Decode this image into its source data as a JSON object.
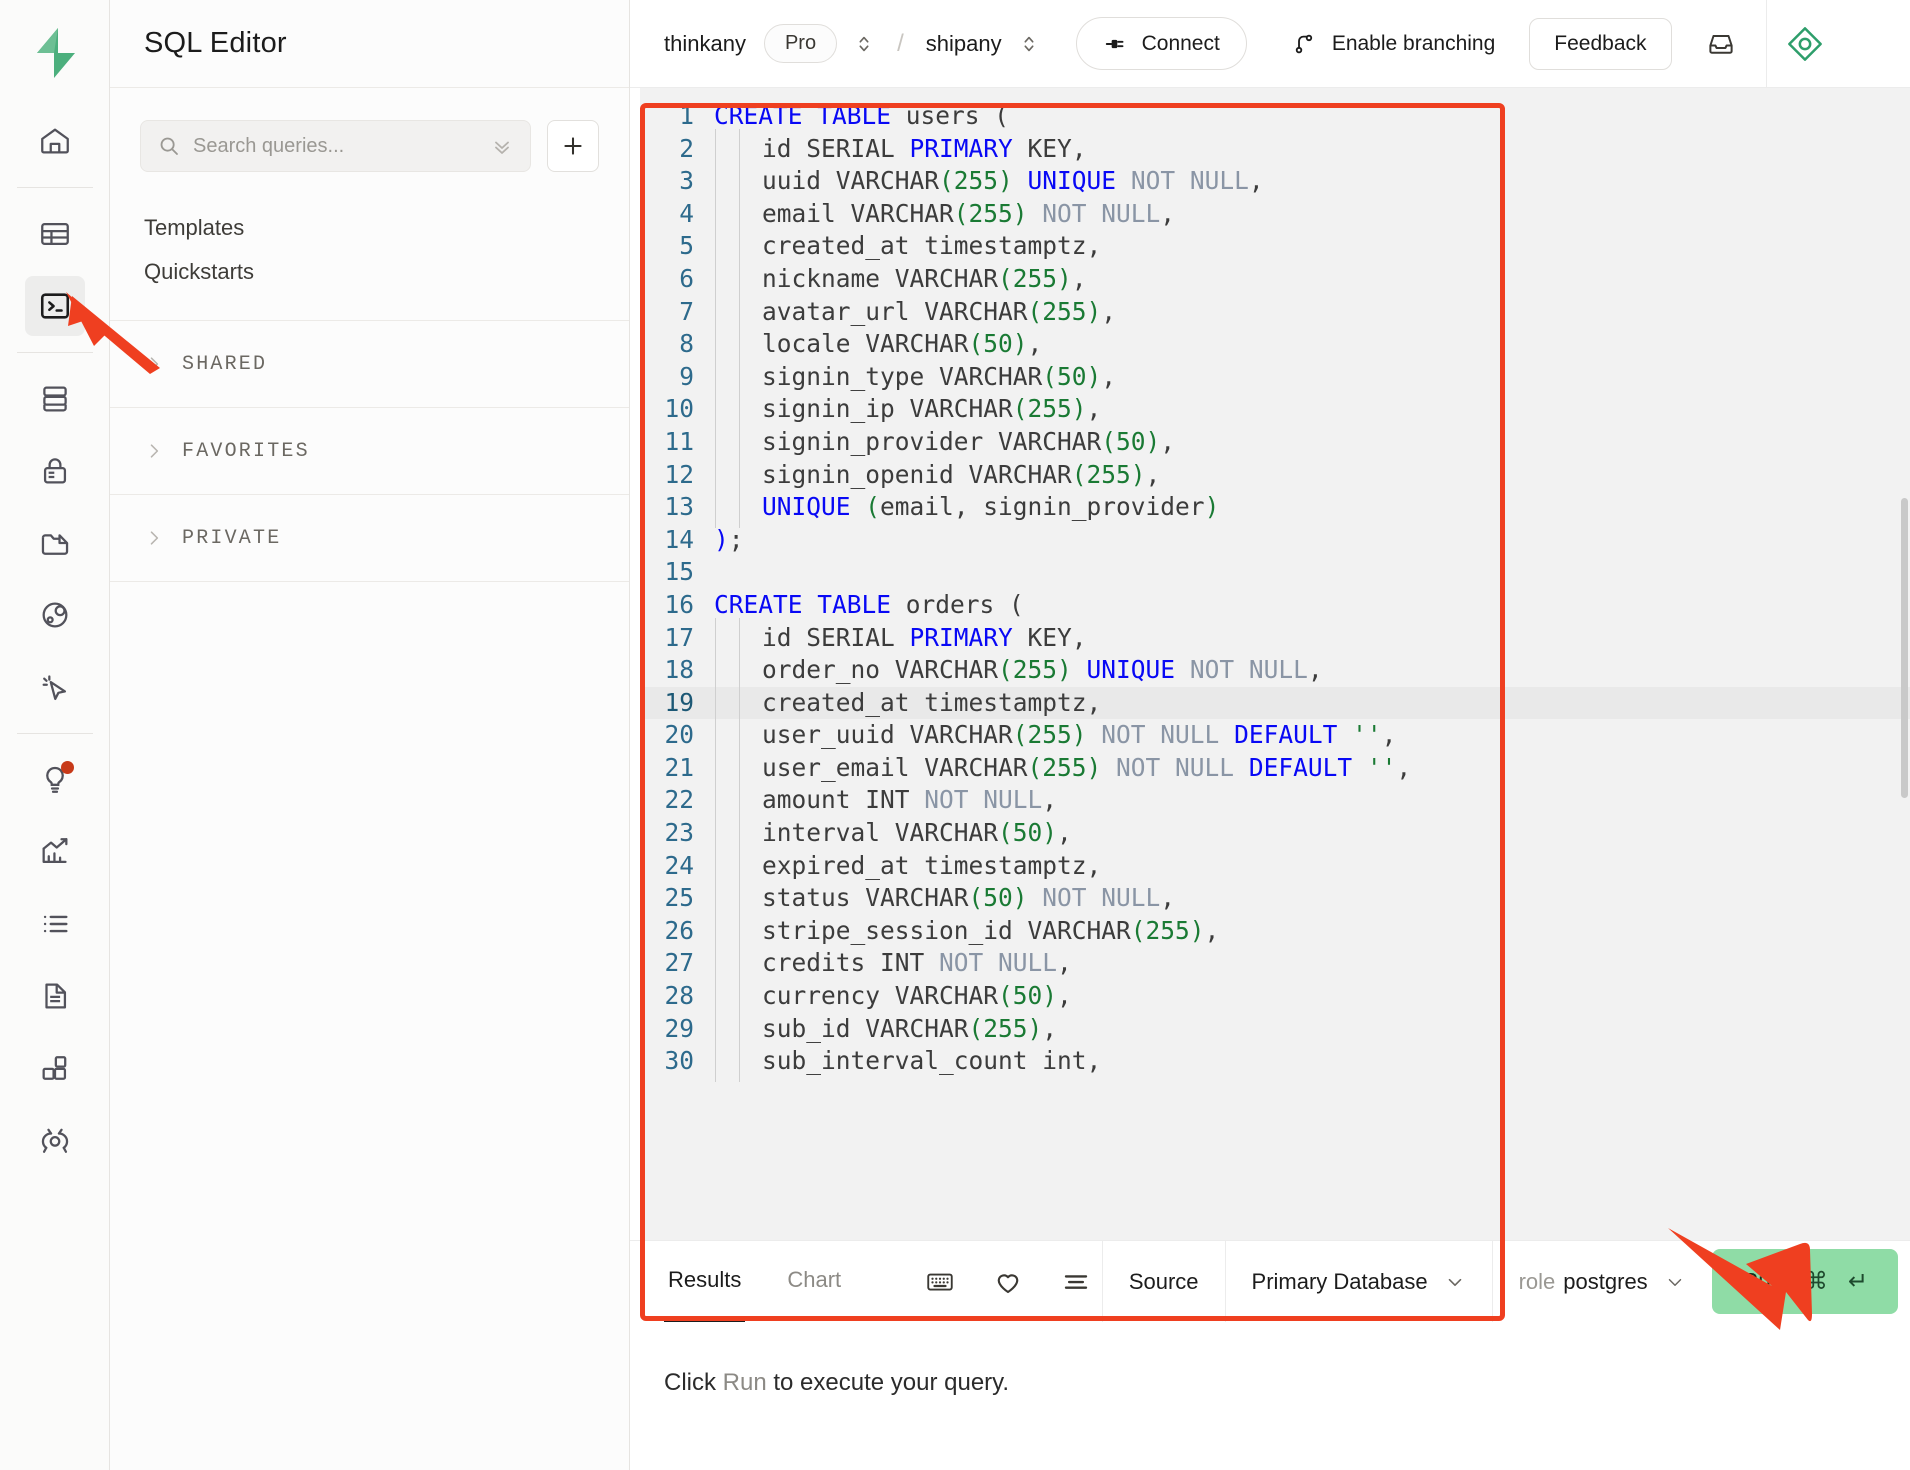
{
  "brand": {
    "logo_icon": "supabase-logo-icon",
    "accent": "#3ecf8e"
  },
  "rail": {
    "items": [
      {
        "name": "home-icon",
        "label": "Home",
        "active": false,
        "badge": false
      },
      {
        "name": "table-editor-icon",
        "label": "Table Editor",
        "active": false,
        "badge": false
      },
      {
        "name": "sql-editor-icon",
        "label": "SQL Editor",
        "active": true,
        "badge": false
      },
      {
        "name": "database-icon",
        "label": "Database",
        "active": false,
        "badge": false
      },
      {
        "name": "auth-lock-icon",
        "label": "Authentication",
        "active": false,
        "badge": false
      },
      {
        "name": "storage-folder-icon",
        "label": "Storage",
        "active": false,
        "badge": false
      },
      {
        "name": "edge-functions-icon",
        "label": "Edge Functions",
        "active": false,
        "badge": false
      },
      {
        "name": "realtime-cursor-icon",
        "label": "Realtime",
        "active": false,
        "badge": false
      },
      {
        "name": "advisors-lightbulb-icon",
        "label": "Advisors",
        "active": false,
        "badge": true
      },
      {
        "name": "reports-chart-icon",
        "label": "Reports",
        "active": false,
        "badge": false
      },
      {
        "name": "logs-list-icon",
        "label": "Logs",
        "active": false,
        "badge": false
      },
      {
        "name": "api-docs-icon",
        "label": "API Docs",
        "active": false,
        "badge": false
      },
      {
        "name": "integrations-blocks-icon",
        "label": "Integrations",
        "active": false,
        "badge": false
      },
      {
        "name": "project-settings-gear-icon",
        "label": "Project Settings",
        "active": false,
        "badge": false
      }
    ]
  },
  "sidebar": {
    "title": "SQL Editor",
    "search": {
      "placeholder": "Search queries...",
      "value": "",
      "icon": "search-icon",
      "expand_icon": "chevrons-down-icon"
    },
    "new_query_label": "+",
    "links": [
      {
        "label": "Templates"
      },
      {
        "label": "Quickstarts"
      }
    ],
    "sections": [
      {
        "label": "SHARED",
        "expanded": false
      },
      {
        "label": "FAVORITES",
        "expanded": false
      },
      {
        "label": "PRIVATE",
        "expanded": false
      }
    ]
  },
  "topbar": {
    "org": "thinkany",
    "plan_badge": "Pro",
    "separator": "/",
    "project": "shipany",
    "connect_label": "Connect",
    "branching_label": "Enable branching",
    "feedback_label": "Feedback",
    "inbox_icon": "inbox-icon",
    "assistant_icon": "assistant-diamond-icon"
  },
  "editor": {
    "highlighted_line": 19,
    "lines": [
      {
        "n": 1,
        "indent": 0,
        "tokens": [
          {
            "t": "CREATE TABLE",
            "c": "kw"
          },
          {
            "t": " users (",
            "c": "src"
          }
        ]
      },
      {
        "n": 2,
        "indent": 2,
        "tokens": [
          {
            "t": "id SERIAL ",
            "c": "src"
          },
          {
            "t": "PRIMARY",
            "c": "kw"
          },
          {
            "t": " KEY,",
            "c": "src"
          }
        ]
      },
      {
        "n": 3,
        "indent": 2,
        "tokens": [
          {
            "t": "uuid VARCHAR",
            "c": "src"
          },
          {
            "t": "(255)",
            "c": "num"
          },
          {
            "t": " ",
            "c": "src"
          },
          {
            "t": "UNIQUE",
            "c": "kw"
          },
          {
            "t": " NOT NULL",
            "c": "null"
          },
          {
            "t": ",",
            "c": "src"
          }
        ]
      },
      {
        "n": 4,
        "indent": 2,
        "tokens": [
          {
            "t": "email VARCHAR",
            "c": "src"
          },
          {
            "t": "(255)",
            "c": "num"
          },
          {
            "t": " NOT NULL",
            "c": "null"
          },
          {
            "t": ",",
            "c": "src"
          }
        ]
      },
      {
        "n": 5,
        "indent": 2,
        "tokens": [
          {
            "t": "created_at timestamptz,",
            "c": "src"
          }
        ]
      },
      {
        "n": 6,
        "indent": 2,
        "tokens": [
          {
            "t": "nickname VARCHAR",
            "c": "src"
          },
          {
            "t": "(255)",
            "c": "num"
          },
          {
            "t": ",",
            "c": "src"
          }
        ]
      },
      {
        "n": 7,
        "indent": 2,
        "tokens": [
          {
            "t": "avatar_url VARCHAR",
            "c": "src"
          },
          {
            "t": "(255)",
            "c": "num"
          },
          {
            "t": ",",
            "c": "src"
          }
        ]
      },
      {
        "n": 8,
        "indent": 2,
        "tokens": [
          {
            "t": "locale VARCHAR",
            "c": "src"
          },
          {
            "t": "(50)",
            "c": "num"
          },
          {
            "t": ",",
            "c": "src"
          }
        ]
      },
      {
        "n": 9,
        "indent": 2,
        "tokens": [
          {
            "t": "signin_type VARCHAR",
            "c": "src"
          },
          {
            "t": "(50)",
            "c": "num"
          },
          {
            "t": ",",
            "c": "src"
          }
        ]
      },
      {
        "n": 10,
        "indent": 2,
        "tokens": [
          {
            "t": "signin_ip VARCHAR",
            "c": "src"
          },
          {
            "t": "(255)",
            "c": "num"
          },
          {
            "t": ",",
            "c": "src"
          }
        ]
      },
      {
        "n": 11,
        "indent": 2,
        "tokens": [
          {
            "t": "signin_provider VARCHAR",
            "c": "src"
          },
          {
            "t": "(50)",
            "c": "num"
          },
          {
            "t": ",",
            "c": "src"
          }
        ]
      },
      {
        "n": 12,
        "indent": 2,
        "tokens": [
          {
            "t": "signin_openid VARCHAR",
            "c": "src"
          },
          {
            "t": "(255)",
            "c": "num"
          },
          {
            "t": ",",
            "c": "src"
          }
        ]
      },
      {
        "n": 13,
        "indent": 2,
        "tokens": [
          {
            "t": "UNIQUE",
            "c": "kw"
          },
          {
            "t": " ",
            "c": "src"
          },
          {
            "t": "(",
            "c": "paren-g"
          },
          {
            "t": "email, signin_provider",
            "c": "src"
          },
          {
            "t": ")",
            "c": "paren-g"
          }
        ]
      },
      {
        "n": 14,
        "indent": 0,
        "tokens": [
          {
            "t": ")",
            "c": "paren-b"
          },
          {
            "t": ";",
            "c": "src"
          }
        ]
      },
      {
        "n": 15,
        "indent": 0,
        "tokens": []
      },
      {
        "n": 16,
        "indent": 0,
        "tokens": [
          {
            "t": "CREATE TABLE",
            "c": "kw"
          },
          {
            "t": " orders (",
            "c": "src"
          }
        ]
      },
      {
        "n": 17,
        "indent": 2,
        "tokens": [
          {
            "t": "id SERIAL ",
            "c": "src"
          },
          {
            "t": "PRIMARY",
            "c": "kw"
          },
          {
            "t": " KEY,",
            "c": "src"
          }
        ]
      },
      {
        "n": 18,
        "indent": 2,
        "tokens": [
          {
            "t": "order_no VARCHAR",
            "c": "src"
          },
          {
            "t": "(255)",
            "c": "num"
          },
          {
            "t": " ",
            "c": "src"
          },
          {
            "t": "UNIQUE",
            "c": "kw"
          },
          {
            "t": " NOT NULL",
            "c": "null"
          },
          {
            "t": ",",
            "c": "src"
          }
        ]
      },
      {
        "n": 19,
        "indent": 2,
        "tokens": [
          {
            "t": "created_at timestamptz,",
            "c": "src"
          }
        ]
      },
      {
        "n": 20,
        "indent": 2,
        "tokens": [
          {
            "t": "user_uuid VARCHAR",
            "c": "src"
          },
          {
            "t": "(255)",
            "c": "num"
          },
          {
            "t": " NOT NULL",
            "c": "null"
          },
          {
            "t": " ",
            "c": "src"
          },
          {
            "t": "DEFAULT",
            "c": "kw"
          },
          {
            "t": " ",
            "c": "src"
          },
          {
            "t": "''",
            "c": "num"
          },
          {
            "t": ",",
            "c": "src"
          }
        ]
      },
      {
        "n": 21,
        "indent": 2,
        "tokens": [
          {
            "t": "user_email VARCHAR",
            "c": "src"
          },
          {
            "t": "(255)",
            "c": "num"
          },
          {
            "t": " NOT NULL",
            "c": "null"
          },
          {
            "t": " ",
            "c": "src"
          },
          {
            "t": "DEFAULT",
            "c": "kw"
          },
          {
            "t": " ",
            "c": "src"
          },
          {
            "t": "''",
            "c": "num"
          },
          {
            "t": ",",
            "c": "src"
          }
        ]
      },
      {
        "n": 22,
        "indent": 2,
        "tokens": [
          {
            "t": "amount INT",
            "c": "src"
          },
          {
            "t": " NOT NULL",
            "c": "null"
          },
          {
            "t": ",",
            "c": "src"
          }
        ]
      },
      {
        "n": 23,
        "indent": 2,
        "tokens": [
          {
            "t": "interval VARCHAR",
            "c": "src"
          },
          {
            "t": "(50)",
            "c": "num"
          },
          {
            "t": ",",
            "c": "src"
          }
        ]
      },
      {
        "n": 24,
        "indent": 2,
        "tokens": [
          {
            "t": "expired_at timestamptz,",
            "c": "src"
          }
        ]
      },
      {
        "n": 25,
        "indent": 2,
        "tokens": [
          {
            "t": "status VARCHAR",
            "c": "src"
          },
          {
            "t": "(50)",
            "c": "num"
          },
          {
            "t": " NOT NULL",
            "c": "null"
          },
          {
            "t": ",",
            "c": "src"
          }
        ]
      },
      {
        "n": 26,
        "indent": 2,
        "tokens": [
          {
            "t": "stripe_session_id VARCHAR",
            "c": "src"
          },
          {
            "t": "(255)",
            "c": "num"
          },
          {
            "t": ",",
            "c": "src"
          }
        ]
      },
      {
        "n": 27,
        "indent": 2,
        "tokens": [
          {
            "t": "credits INT",
            "c": "src"
          },
          {
            "t": " NOT NULL",
            "c": "null"
          },
          {
            "t": ",",
            "c": "src"
          }
        ]
      },
      {
        "n": 28,
        "indent": 2,
        "tokens": [
          {
            "t": "currency VARCHAR",
            "c": "src"
          },
          {
            "t": "(50)",
            "c": "num"
          },
          {
            "t": ",",
            "c": "src"
          }
        ]
      },
      {
        "n": 29,
        "indent": 2,
        "tokens": [
          {
            "t": "sub_id VARCHAR",
            "c": "src"
          },
          {
            "t": "(255)",
            "c": "num"
          },
          {
            "t": ",",
            "c": "src"
          }
        ]
      },
      {
        "n": 30,
        "indent": 2,
        "tokens": [
          {
            "t": "sub_interval_count int,",
            "c": "src"
          }
        ]
      }
    ]
  },
  "results_bar": {
    "tabs": [
      {
        "label": "Results",
        "active": true
      },
      {
        "label": "Chart",
        "active": false
      }
    ],
    "icons": [
      {
        "name": "keyboard-shortcuts-icon"
      },
      {
        "name": "favorite-heart-icon"
      },
      {
        "name": "format-lines-icon"
      }
    ],
    "source_label": "Source",
    "database_label": "Primary Database",
    "role_prefix": "role",
    "role_value": "postgres",
    "run_label": "Run",
    "run_shortcut_cmd": "⌘",
    "run_shortcut_enter": "↵",
    "run_color": "#8fdca6"
  },
  "footer": {
    "prefix": "Click ",
    "run_word": "Run",
    "suffix": " to execute your query."
  },
  "annotations": {
    "box_color": "#ef3f20",
    "arrow_sql_editor": "arrow-pointing-sql-editor-rail-icon",
    "arrow_run": "arrow-pointing-run-button"
  }
}
